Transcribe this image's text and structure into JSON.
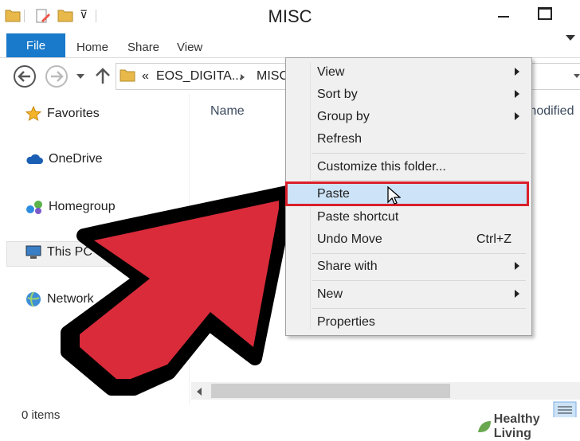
{
  "window": {
    "title": "MISC"
  },
  "ribbon": {
    "file_tab": "File",
    "tabs": [
      "Home",
      "Share",
      "View"
    ]
  },
  "address": {
    "chevron": "«",
    "path": [
      "EOS_DIGITA...",
      "MISC"
    ]
  },
  "nav": {
    "items": [
      {
        "label": "Favorites",
        "icon": "star-icon"
      },
      {
        "label": "OneDrive",
        "icon": "cloud-icon"
      },
      {
        "label": "Homegroup",
        "icon": "homegroup-icon"
      },
      {
        "label": "This PC",
        "icon": "computer-icon"
      },
      {
        "label": "Network",
        "icon": "network-icon"
      }
    ]
  },
  "content": {
    "columns": [
      "Name",
      "modified"
    ]
  },
  "status": {
    "items_text": "0 items"
  },
  "context_menu": {
    "items": [
      {
        "label": "View",
        "submenu": true
      },
      {
        "label": "Sort by",
        "submenu": true
      },
      {
        "label": "Group by",
        "submenu": true
      },
      {
        "label": "Refresh",
        "submenu": false
      },
      {
        "label": "Customize this folder...",
        "submenu": false
      },
      {
        "label": "Paste",
        "submenu": false,
        "highlighted": true
      },
      {
        "label": "Paste shortcut",
        "submenu": false
      },
      {
        "label": "Undo Move",
        "submenu": false,
        "shortcut": "Ctrl+Z"
      },
      {
        "label": "Share with",
        "submenu": true
      },
      {
        "label": "New",
        "submenu": true
      },
      {
        "label": "Properties",
        "submenu": false
      }
    ]
  },
  "watermark": {
    "text": "Healthy Living"
  },
  "colors": {
    "accent": "#1979ca",
    "highlight_border": "#d9202b",
    "arrow_fill": "#d92b3a",
    "selection": "#cde3f7"
  }
}
